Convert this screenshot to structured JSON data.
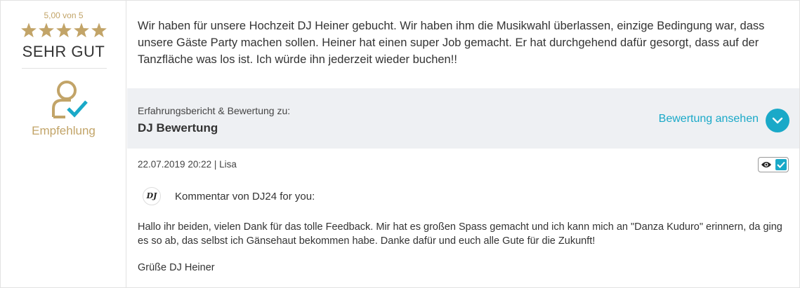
{
  "rating": {
    "score_text": "5,00 von 5",
    "stars": 5,
    "stars_max": 5,
    "grade": "SEHR GUT",
    "recommendation_label": "Empfehlung",
    "accent_color": "#c2a468"
  },
  "review": {
    "text": "Wir haben für unsere Hochzeit DJ Heiner gebucht. Wir haben ihm die Musikwahl überlassen, einzige Bedingung war, dass unsere Gäste Party machen sollen. Heiner hat einen super Job gemacht. Er hat durchgehend dafür gesorgt, dass auf der Tanzfläche was los ist. Ich würde ihn jederzeit wieder buchen!!"
  },
  "context_bar": {
    "subtitle": "Erfahrungsbericht & Bewertung zu:",
    "title": "DJ Bewertung",
    "view_link": "Bewertung ansehen",
    "view_icon": "chevron-down-icon",
    "link_color": "#1aa9c8"
  },
  "meta": {
    "date_author": "22.07.2019 20:22 | Lisa",
    "visibility_icons": [
      "eye-icon",
      "checkmark-icon"
    ]
  },
  "comment": {
    "logo_text": "DJ",
    "heading": "Kommentar von DJ24 for you:",
    "body": "Hallo ihr beiden, vielen Dank für das tolle Feedback. Mir hat es großen Spass gemacht und ich kann mich an \"Danza Kuduro\" erinnern, da ging es so ab, das selbst ich Gänsehaut bekommen habe. Danke dafür und euch alle Gute für die Zukunft!",
    "signature": "Grüße DJ Heiner"
  }
}
